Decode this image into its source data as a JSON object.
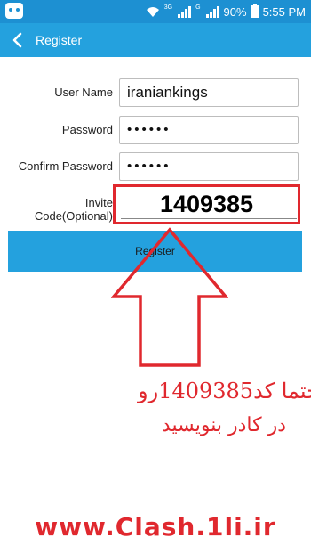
{
  "status_bar": {
    "network_3g": "3G",
    "network_g": "G",
    "battery": "90%",
    "time": "5:55 PM"
  },
  "header": {
    "title": "Register"
  },
  "form": {
    "username_label": "User Name",
    "username_value": "iraniankings",
    "password_label": "Password",
    "password_value": "••••••",
    "confirm_label": "Confirm Password",
    "confirm_value": "••••••",
    "invite_label_line1": "Invite",
    "invite_label_line2": "Code(Optional)",
    "invite_value": "1409385",
    "register_label": "Register"
  },
  "overlay": {
    "line1": "حتما کد1409385رو",
    "line2": "در کادر بنویسید",
    "url": "www.Clash.1li.ir"
  },
  "colors": {
    "status_bar": "#1d90d2",
    "app_bar": "#24a1de",
    "annotation_red": "#e0282e"
  }
}
